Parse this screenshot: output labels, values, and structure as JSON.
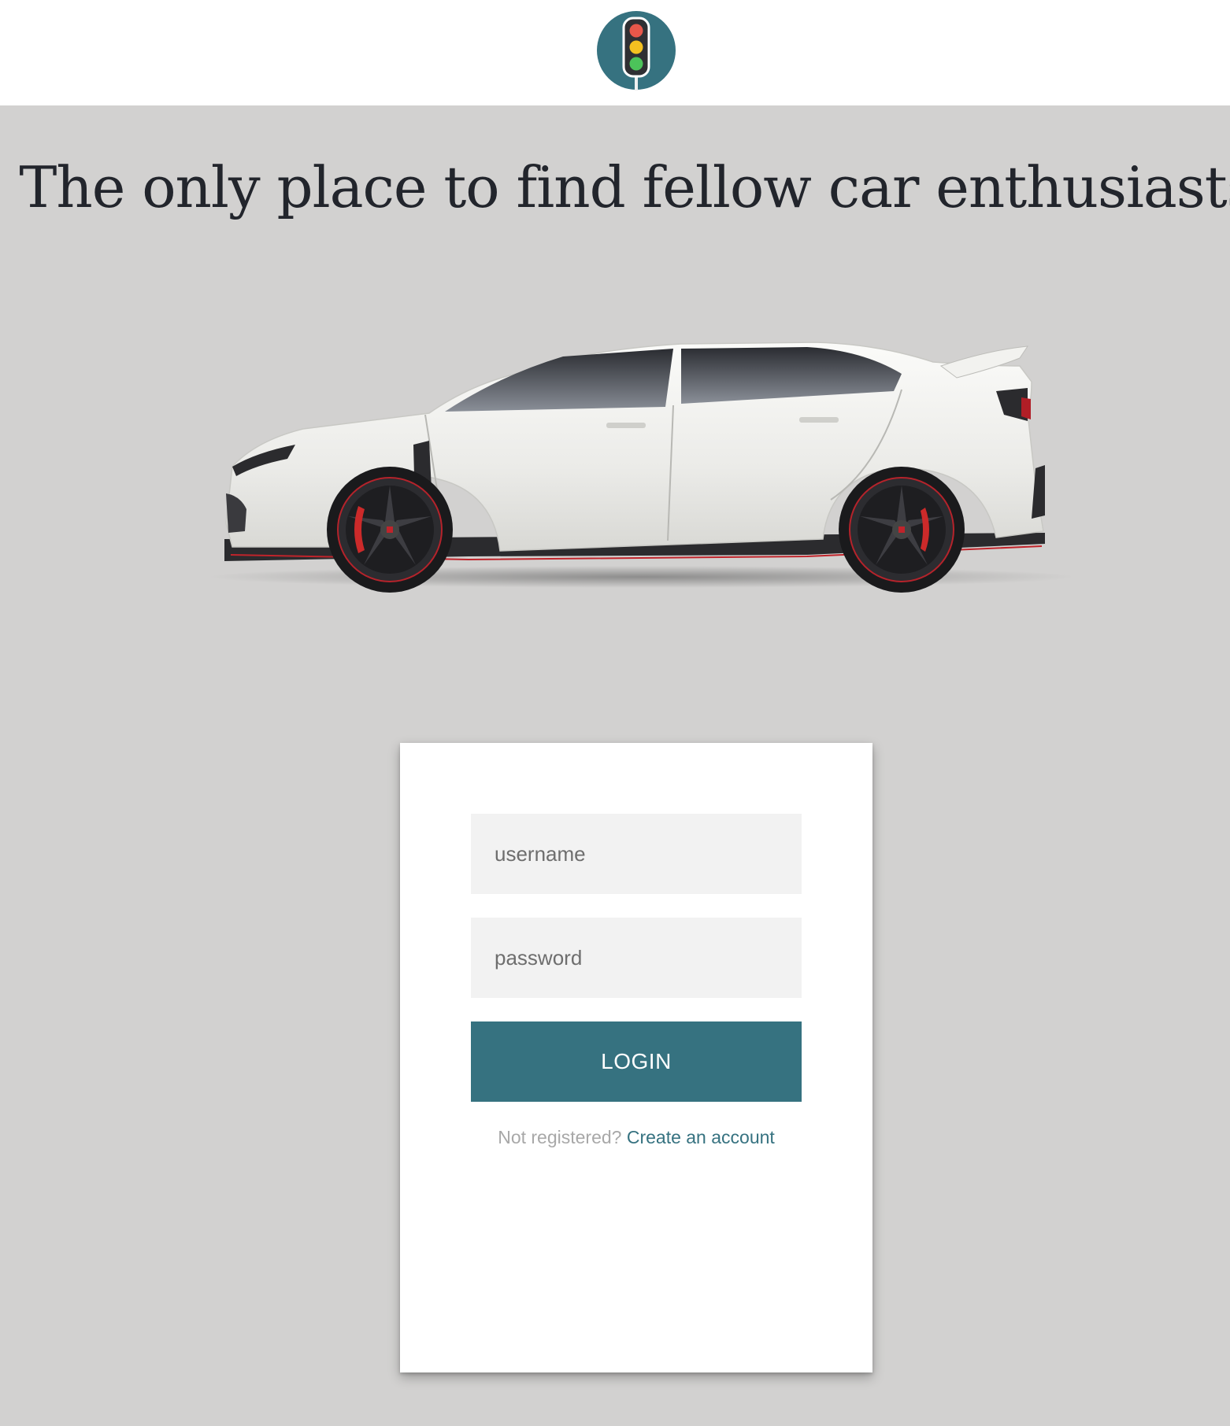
{
  "header": {
    "logo_icon": "traffic-light-icon",
    "colors": {
      "logo_bg": "#367280"
    }
  },
  "hero": {
    "headline": "The only place to find fellow car enthusiasts",
    "car_image": "white-hatchback-car-side-view"
  },
  "login": {
    "username_placeholder": "username",
    "password_placeholder": "password",
    "login_label": "LOGIN",
    "register_prompt": "Not registered?",
    "register_link": "Create an account"
  },
  "colors": {
    "accent": "#367280",
    "page_bg": "#d2d1d0",
    "field_bg": "#f2f2f2",
    "headline_text": "#22252c"
  }
}
